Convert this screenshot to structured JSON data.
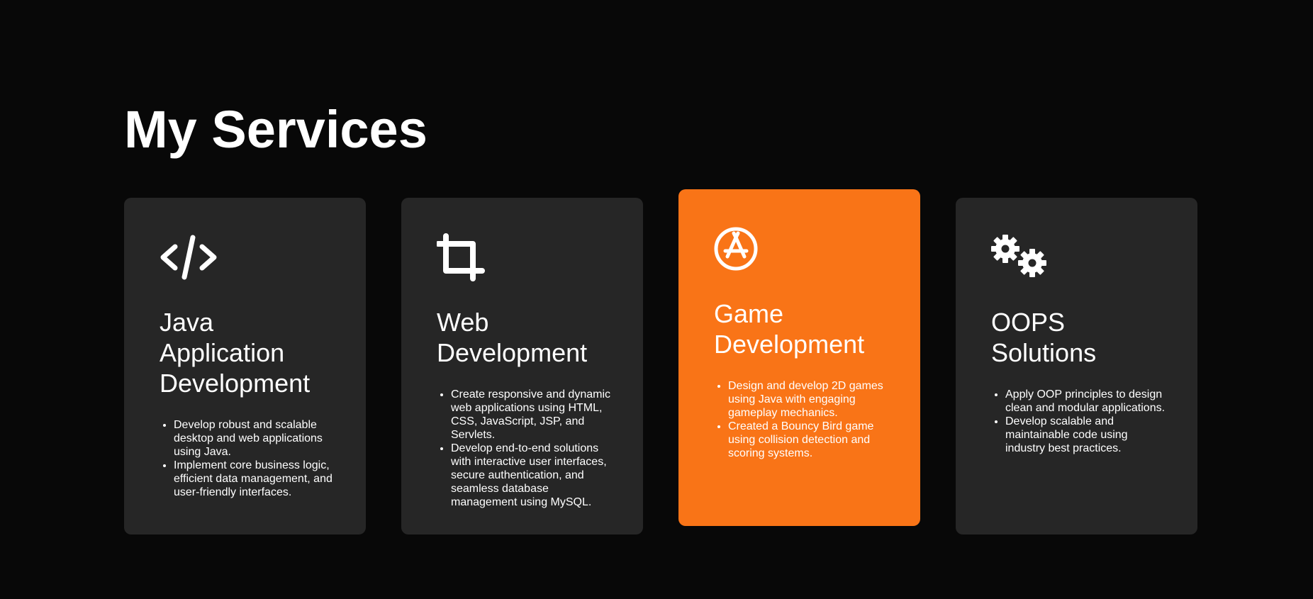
{
  "section": {
    "title": "My Services"
  },
  "colors": {
    "background": "#080808",
    "card": "#262626",
    "accent": "#f97417",
    "text": "#ffffff"
  },
  "cards": [
    {
      "icon": "code-icon",
      "title": "Java Application Development",
      "bullets": [
        "Develop robust and scalable desktop and web applications using Java.",
        "Implement core business logic, efficient data management, and user-friendly interfaces."
      ]
    },
    {
      "icon": "crop-icon",
      "title": "Web Development",
      "bullets": [
        "Create responsive and dynamic web applications using HTML, CSS, JavaScript, JSP, and Servlets.",
        "Develop end-to-end solutions with interactive user interfaces, secure authentication, and seamless database management using MySQL."
      ]
    },
    {
      "icon": "app-store-icon",
      "title": "Game Development",
      "active": true,
      "bullets": [
        "Design and develop 2D games using Java with engaging gameplay mechanics.",
        "Created a Bouncy Bird game using collision detection and scoring systems."
      ]
    },
    {
      "icon": "gears-icon",
      "title": "OOPS Solutions",
      "bullets": [
        "Apply OOP principles to design clean and modular applications.",
        "Develop scalable and maintainable code using industry best practices."
      ]
    }
  ]
}
